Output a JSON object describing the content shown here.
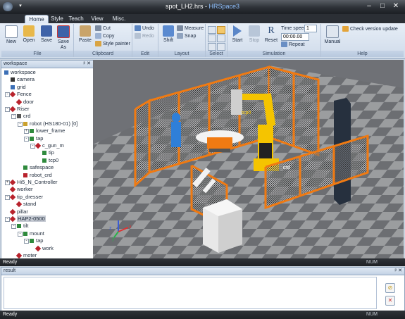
{
  "window": {
    "title_doc": "spot_LH2.hrs",
    "title_sep": " - ",
    "title_app": "HRSpace3",
    "min": "–",
    "max": "□",
    "close": "✕"
  },
  "tabs": [
    "Home",
    "Style",
    "Teach",
    "View",
    "Misc."
  ],
  "ribbon": {
    "file": {
      "label": "File",
      "new": "New",
      "open": "Open",
      "save": "Save",
      "save_as_1": "Save",
      "save_as_2": "As"
    },
    "clipboard": {
      "label": "Clipboard",
      "paste": "Paste",
      "cut": "Cut",
      "copy": "Copy",
      "style_painter": "Style painter"
    },
    "edit": {
      "label": "Edit",
      "undo": "Undo",
      "redo": "Redo"
    },
    "layout": {
      "label": "Layout",
      "shift": "Shift",
      "measure": "Measure",
      "snap": "Snap"
    },
    "select": {
      "label": "Select"
    },
    "simulation": {
      "label": "Simulation",
      "start": "Start",
      "stop": "Stop",
      "reset": "Reset",
      "time_speed_label": "Time speed",
      "time_speed_value": "1",
      "time_value": "00:00.00",
      "repeat": "Repeat"
    },
    "help": {
      "label": "Help",
      "manual": "Manual",
      "check_update": "Check version update"
    }
  },
  "workspace": {
    "title": "workspace",
    "header_buttons": "ᵖ ✕",
    "tree": [
      {
        "label": "workspace",
        "icon": "workspace-icon"
      },
      {
        "label": "camera",
        "icon": "camera-icon"
      },
      {
        "label": "grid",
        "icon": "grid-icon"
      },
      {
        "label": "Fence",
        "icon": "object-icon"
      },
      {
        "label": "door",
        "icon": "object-icon"
      },
      {
        "label": "Riser",
        "icon": "object-icon"
      },
      {
        "label": "crd",
        "icon": "frame-icon"
      },
      {
        "label": "robot (HS180-01) [0]",
        "icon": "robot-icon"
      },
      {
        "label": "lower_frame",
        "icon": "frame-icon"
      },
      {
        "label": "tap",
        "icon": "frame-icon"
      },
      {
        "label": "c_gun_m",
        "icon": "object-icon"
      },
      {
        "label": "tip",
        "icon": "frame-icon"
      },
      {
        "label": "tcp0",
        "icon": "frame-icon"
      },
      {
        "label": "safespace",
        "icon": "safespace-icon"
      },
      {
        "label": "robot_crd",
        "icon": "frame-icon"
      },
      {
        "label": "Hi5_N_Controller",
        "icon": "object-icon"
      },
      {
        "label": "worker",
        "icon": "object-icon"
      },
      {
        "label": "tip_dresser",
        "icon": "object-icon"
      },
      {
        "label": "stand",
        "icon": "object-icon"
      },
      {
        "label": "pillar",
        "icon": "object-icon"
      },
      {
        "label": "HAP2-0500",
        "icon": "object-icon"
      },
      {
        "label": "tilt",
        "icon": "frame-icon"
      },
      {
        "label": "mount",
        "icon": "frame-icon"
      },
      {
        "label": "tap",
        "icon": "frame-icon"
      },
      {
        "label": "work",
        "icon": "object-icon"
      },
      {
        "label": "moter",
        "icon": "object-icon"
      }
    ]
  },
  "viewport": {
    "labels": {
      "tcp0": "tcp0",
      "crd": "_crd"
    },
    "axes": {
      "x": "x",
      "y": "y",
      "z": "z"
    }
  },
  "status": {
    "text": "Ready",
    "num": "NUM"
  },
  "result": {
    "title": "result",
    "header_buttons": "ᵖ ✕"
  },
  "colors": {
    "fence": "#f07a12",
    "robot": "#f5c400",
    "accent": "#3b6fb6"
  }
}
